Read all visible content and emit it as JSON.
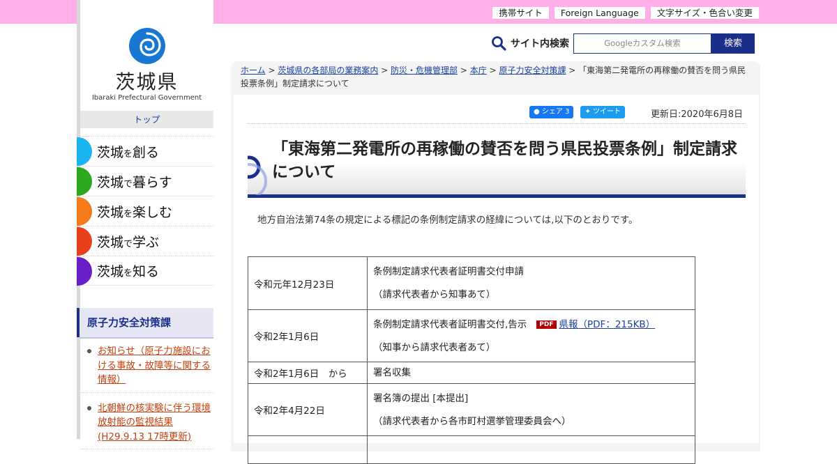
{
  "header": {
    "links": [
      "携帯サイト",
      "Foreign Language",
      "文字サイズ・色合い変更"
    ]
  },
  "logo": {
    "name_jp": "茨城県",
    "name_en": "Ibaraki Prefectural Government"
  },
  "sidebar": {
    "top_label": "トップ",
    "menu": [
      {
        "prefix": "茨城",
        "particle": "を",
        "rest": "創る",
        "color": "#1ab4f0"
      },
      {
        "prefix": "茨城",
        "particle": "で",
        "rest": "暮らす",
        "color": "#2aa81e"
      },
      {
        "prefix": "茨城",
        "particle": "を",
        "rest": "楽しむ",
        "color": "#f47a1a"
      },
      {
        "prefix": "茨城",
        "particle": "で",
        "rest": "学ぶ",
        "color": "#e8401a"
      },
      {
        "prefix": "茨城",
        "particle": "を",
        "rest": "知る",
        "color": "#6a1ec8"
      }
    ],
    "section_title": "原子力安全対策課",
    "links": [
      "お知らせ（原子力施設における事故・故障等に関する情報）",
      "北朝鮮の核実験に伴う環境放射能の監視結果(H29.9.13 17時更新)"
    ]
  },
  "search": {
    "label": "サイト内検索",
    "placeholder": "Googleカスタム検索",
    "button": "検索"
  },
  "breadcrumb": {
    "items": [
      "ホーム",
      "茨城県の各部局の業務案内",
      "防災・危機管理部",
      "本庁",
      "原子力安全対策課"
    ],
    "current": "「東海第二発電所の再稼働の賛否を問う県民投票条例」制定請求について"
  },
  "share": {
    "facebook": "シェア 3",
    "twitter": "ツイート"
  },
  "updated": "更新日:2020年6月8日",
  "page_title": "「東海第二発電所の再稼働の賛否を問う県民投票条例」制定請求について",
  "intro": "地方自治法第74条の規定による標記の条例制定請求の経緯については,以下のとおりです。",
  "timeline": [
    {
      "date": "令和元年12月23日",
      "line1": "条例制定請求代表者証明書交付申請",
      "line2": "（請求代表者から知事あて）"
    },
    {
      "date": "令和2年1月6日",
      "line1": "条例制定請求代表者証明書交付,告示",
      "pdf_tag": "PDF",
      "pdf_link": "県報（PDF：215KB）",
      "line2": "（知事から請求代表者あて）"
    },
    {
      "date": "令和2年1月6日　から",
      "line1": "署名収集"
    },
    {
      "date": "令和2年4月22日",
      "line1": "署名簿の提出 [本提出]",
      "line2": "（請求代表者から各市町村選挙管理委員会へ）"
    }
  ],
  "colors": {
    "top_bar": "#ffaee8",
    "brand_navy": "#1a2f8a",
    "logo_blue": "#1877d2"
  }
}
